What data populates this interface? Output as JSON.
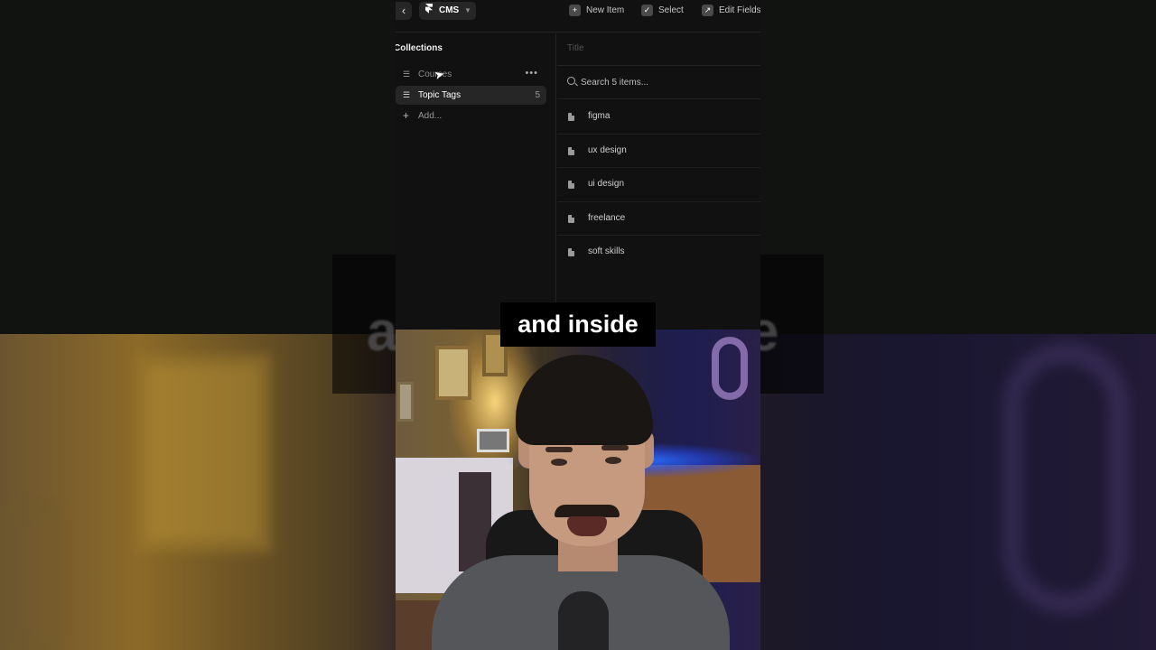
{
  "toolbar": {
    "back_icon": "‹",
    "cms_label": "CMS",
    "cms_logo_icon": "framer-logo-icon",
    "new_item_label": "New Item",
    "select_label": "Select",
    "edit_fields_label": "Edit Fields"
  },
  "sidebar": {
    "title": "Collections",
    "items": [
      {
        "label": "Courses",
        "icon": "database-icon",
        "state": "hover"
      },
      {
        "label": "Topic Tags",
        "icon": "database-icon",
        "count": "5",
        "state": "selected"
      },
      {
        "label": "Add...",
        "icon": "plus-icon"
      }
    ]
  },
  "main": {
    "column_title": "Title",
    "search_placeholder": "Search 5 items...",
    "items": [
      {
        "label": "figma"
      },
      {
        "label": "ux design"
      },
      {
        "label": "ui design"
      },
      {
        "label": "freelance"
      },
      {
        "label": "soft skills"
      }
    ]
  },
  "caption": "and inside",
  "background_caption_fragments": {
    "left": "a",
    "right": "e"
  },
  "colors": {
    "app_bg": "#111111",
    "selected_row": "#262626",
    "caption_bg": "#000000",
    "caption_text": "#ffffff"
  }
}
